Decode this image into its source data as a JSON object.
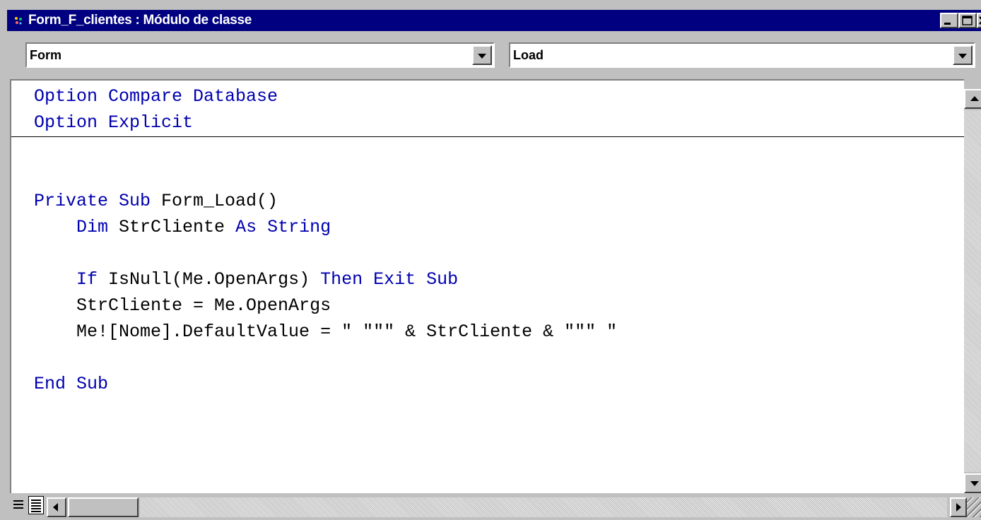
{
  "window": {
    "title": "Form_F_clientes : Módulo de classe",
    "controls": {
      "minimize": "_",
      "maximize": "□",
      "close": "×"
    }
  },
  "object_combo": {
    "value": "Form"
  },
  "procedure_combo": {
    "value": "Load"
  },
  "code": {
    "lines": [
      [
        {
          "t": "Option Compare Database",
          "kw": true
        }
      ],
      [
        {
          "t": "Option Explicit",
          "kw": true
        }
      ],
      [],
      [],
      [
        {
          "t": "Private Sub",
          "kw": true
        },
        {
          "t": " Form_Load()"
        }
      ],
      [
        {
          "t": "    "
        },
        {
          "t": "Dim",
          "kw": true
        },
        {
          "t": " StrCliente "
        },
        {
          "t": "As String",
          "kw": true
        }
      ],
      [],
      [
        {
          "t": "    "
        },
        {
          "t": "If",
          "kw": true
        },
        {
          "t": " IsNull(Me.OpenArgs) "
        },
        {
          "t": "Then Exit Sub",
          "kw": true
        }
      ],
      [
        {
          "t": "    StrCliente = Me.OpenArgs"
        }
      ],
      [
        {
          "t": "    Me![Nome].DefaultValue = \" \"\"\" & StrCliente & \"\"\" \""
        }
      ],
      [],
      [
        {
          "t": "End Sub",
          "kw": true
        }
      ]
    ]
  },
  "colors": {
    "titlebar": "#000080",
    "keyword": "#0000b0",
    "face": "#c0c0c0"
  },
  "icons": [
    "module-icon",
    "minimize-icon",
    "maximize-icon",
    "close-icon",
    "dropdown-arrow-icon",
    "procedure-view-icon",
    "full-module-view-icon",
    "scroll-left-icon",
    "scroll-right-icon",
    "scroll-up-icon",
    "scroll-down-icon"
  ]
}
